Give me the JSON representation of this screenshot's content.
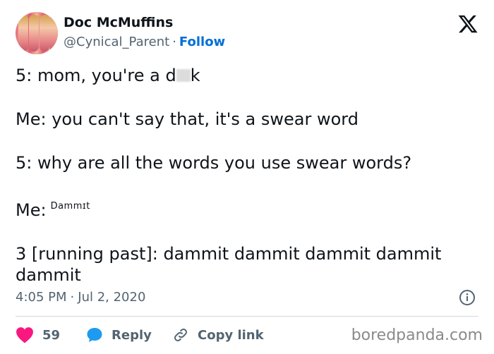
{
  "user": {
    "name": "Doc McMuffins",
    "handle": "@Cynical_Parent",
    "separator": "·",
    "follow_label": "Follow"
  },
  "header_icon": "x-logo-icon",
  "tweet": {
    "line1_prefix": "5: mom, you're a d",
    "line1_suffix": "k",
    "line2": "Me: you can't say that, it's a swear word",
    "line3": "5: why are all the words you use swear words?",
    "line4_prefix": "Me:",
    "line4_small": "Dammɪt",
    "line5": "3 [running past]: dammit dammit dammit dammit dammit"
  },
  "meta": {
    "time": "4:05 PM",
    "separator": "·",
    "date": "Jul 2, 2020"
  },
  "actions": {
    "like_count": "59",
    "reply_label": "Reply",
    "copy_label": "Copy link"
  },
  "watermark": "boredpanda.com",
  "colors": {
    "like": "#f91880",
    "reply": "#1d9bf0",
    "follow": "#006fd6",
    "muted": "#536471"
  }
}
